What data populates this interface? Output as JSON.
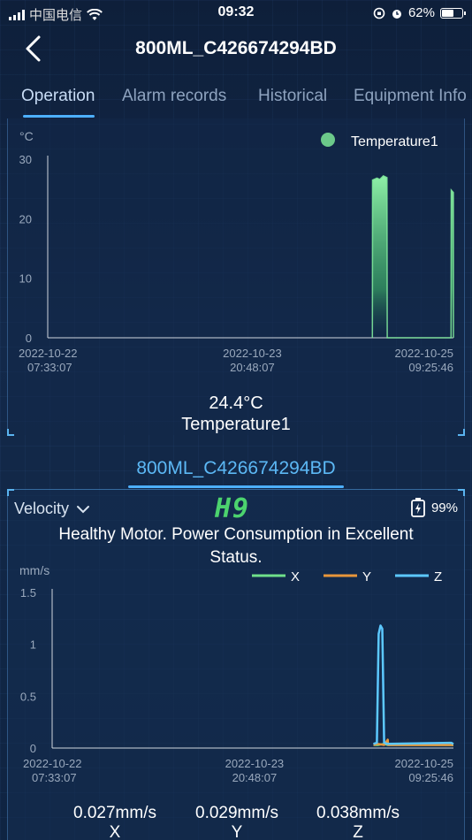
{
  "status_bar": {
    "carrier": "中国电信",
    "time": "09:32",
    "battery_percent": "62%",
    "battery_level": 0.62
  },
  "header": {
    "title": "800ML_C426674294BD"
  },
  "tabs": [
    {
      "label": "Operation",
      "active": true
    },
    {
      "label": "Alarm records",
      "active": false
    },
    {
      "label": "Historical",
      "active": false
    },
    {
      "label": "Equipment Info",
      "active": false
    }
  ],
  "temperature_panel": {
    "reading_value": "24.4°C",
    "reading_label": "Temperature1"
  },
  "device_heading": "800ML_C426674294BD",
  "velocity_panel": {
    "selector_label": "Velocity",
    "health_badge": "H9",
    "battery_percent": "99%",
    "battery_level": 0.99,
    "health_message": "Healthy Motor.  Power Consumption in Excellent Status.",
    "readings": [
      {
        "value": "0.027mm/s",
        "axis": "X"
      },
      {
        "value": "0.029mm/s",
        "axis": "Y"
      },
      {
        "value": "0.038mm/s",
        "axis": "Z"
      }
    ]
  },
  "chart_data": [
    {
      "type": "area",
      "ylabel": "°C",
      "ylim": [
        0,
        30
      ],
      "yticks": [
        "0",
        "10",
        "20",
        "30"
      ],
      "xticks": [
        {
          "date": "2022-10-22",
          "time": "07:33:07"
        },
        {
          "date": "2022-10-23",
          "time": "20:48:07"
        },
        {
          "date": "2022-10-25",
          "time": "09:25:46"
        }
      ],
      "legend": "top-right",
      "grid": false,
      "series": [
        {
          "name": "Temperature1",
          "color": "#7ee89a",
          "points": [
            {
              "t": "2022-10-24 18:40",
              "v": 0
            },
            {
              "t": "2022-10-24 18:42",
              "v": 26.5
            },
            {
              "t": "2022-10-24 19:30",
              "v": 26.8
            },
            {
              "t": "2022-10-24 20:00",
              "v": 26.6
            },
            {
              "t": "2022-10-24 20:40",
              "v": 27.2
            },
            {
              "t": "2022-10-24 21:20",
              "v": 26.9
            },
            {
              "t": "2022-10-24 21:22",
              "v": 0
            },
            {
              "t": "2022-10-25 09:00",
              "v": 0
            },
            {
              "t": "2022-10-25 09:02",
              "v": 24.8
            },
            {
              "t": "2022-10-25 09:25",
              "v": 24.4
            },
            {
              "t": "2022-10-25 09:26",
              "v": 0
            }
          ]
        }
      ]
    },
    {
      "type": "line",
      "ylabel": "mm/s",
      "ylim": [
        0,
        1.5
      ],
      "yticks": [
        "0",
        "0.5",
        "1",
        "1.5"
      ],
      "xticks": [
        {
          "date": "2022-10-22",
          "time": "07:33:07"
        },
        {
          "date": "2022-10-23",
          "time": "20:48:07"
        },
        {
          "date": "2022-10-25",
          "time": "09:25:46"
        }
      ],
      "legend": "top-right",
      "grid": false,
      "series": [
        {
          "name": "X",
          "color": "#6fe08a",
          "points": [
            {
              "t": "2022-10-24 18:42",
              "v": 0.03
            },
            {
              "t": "2022-10-24 19:30",
              "v": 0.03
            },
            {
              "t": "2022-10-24 20:40",
              "v": 0.04
            },
            {
              "t": "2022-10-24 21:20",
              "v": 0.03
            },
            {
              "t": "2022-10-25 09:02",
              "v": 0.03
            },
            {
              "t": "2022-10-25 09:25",
              "v": 0.027
            }
          ]
        },
        {
          "name": "Y",
          "color": "#e8963a",
          "points": [
            {
              "t": "2022-10-24 18:42",
              "v": 0.03
            },
            {
              "t": "2022-10-24 19:30",
              "v": 0.04
            },
            {
              "t": "2022-10-24 20:40",
              "v": 0.03
            },
            {
              "t": "2022-10-24 21:20",
              "v": 0.08
            },
            {
              "t": "2022-10-24 21:22",
              "v": 0.03
            },
            {
              "t": "2022-10-25 09:02",
              "v": 0.03
            },
            {
              "t": "2022-10-25 09:25",
              "v": 0.029
            }
          ]
        },
        {
          "name": "Z",
          "color": "#5cc8ff",
          "points": [
            {
              "t": "2022-10-24 18:42",
              "v": 0.04
            },
            {
              "t": "2022-10-24 19:20",
              "v": 0.05
            },
            {
              "t": "2022-10-24 19:40",
              "v": 1.1
            },
            {
              "t": "2022-10-24 20:00",
              "v": 1.18
            },
            {
              "t": "2022-10-24 20:20",
              "v": 1.15
            },
            {
              "t": "2022-10-24 20:40",
              "v": 0.05
            },
            {
              "t": "2022-10-24 21:20",
              "v": 0.04
            },
            {
              "t": "2022-10-25 09:02",
              "v": 0.05
            },
            {
              "t": "2022-10-25 09:25",
              "v": 0.038
            }
          ]
        }
      ]
    }
  ]
}
